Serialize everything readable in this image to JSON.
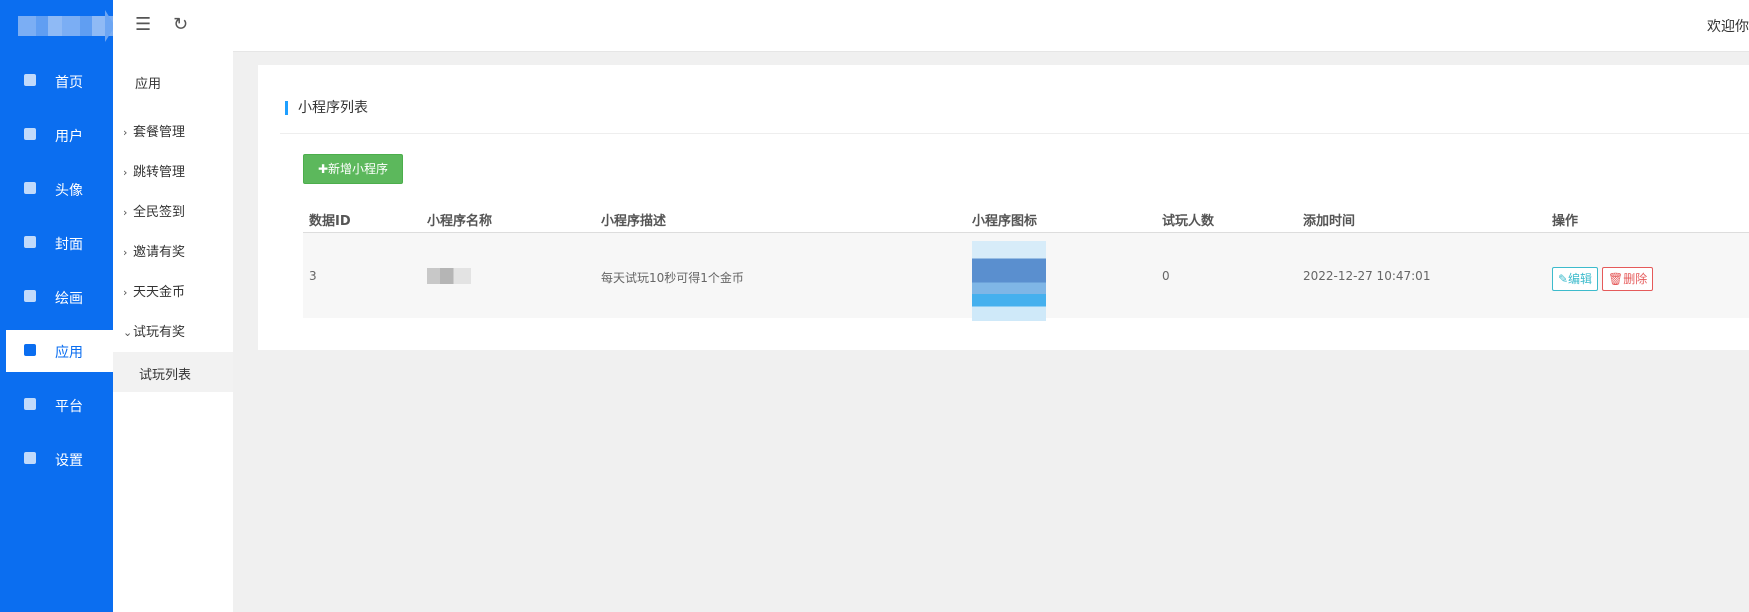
{
  "header": {
    "welcome_text": "欢迎你",
    "menu_toggle_icon": "menu-fold-icon",
    "refresh_icon": "refresh-icon"
  },
  "left_nav": {
    "items": [
      {
        "label": "首页",
        "icon": "home-icon"
      },
      {
        "label": "用户",
        "icon": "diamond-icon"
      },
      {
        "label": "头像",
        "icon": "user-card-icon"
      },
      {
        "label": "封面",
        "icon": "image-icon"
      },
      {
        "label": "绘画",
        "icon": "picture-icon"
      },
      {
        "label": "应用",
        "icon": "app-icon",
        "active": true
      },
      {
        "label": "平台",
        "icon": "platform-icon"
      },
      {
        "label": "设置",
        "icon": "settings-icon"
      }
    ]
  },
  "sub_nav": {
    "title": "应用",
    "items": [
      {
        "label": "套餐管理",
        "arrow": "›"
      },
      {
        "label": "跳转管理",
        "arrow": "›"
      },
      {
        "label": "全民签到",
        "arrow": "›"
      },
      {
        "label": "邀请有奖",
        "arrow": "›"
      },
      {
        "label": "天天金币",
        "arrow": "›"
      },
      {
        "label": "试玩有奖",
        "arrow": "⌄"
      }
    ],
    "child": "试玩列表"
  },
  "main": {
    "title": "小程序列表",
    "add_button": "✚新增小程序",
    "columns": [
      "数据ID",
      "小程序名称",
      "小程序描述",
      "小程序图标",
      "试玩人数",
      "添加时间",
      "操作"
    ],
    "rows": [
      {
        "id": "3",
        "description": "每天试玩10秒可得1个金币",
        "players": "0",
        "added_time": "2022-12-27 10:47:01",
        "edit_label": "✎编辑",
        "delete_label": "🗑删除"
      }
    ]
  },
  "colors": {
    "nav_blue": "#0b6ef0",
    "add_green": "#5cb85c",
    "title_accent": "#1e9fff",
    "edit": "#3dbbcc",
    "delete": "#e55a5a"
  }
}
